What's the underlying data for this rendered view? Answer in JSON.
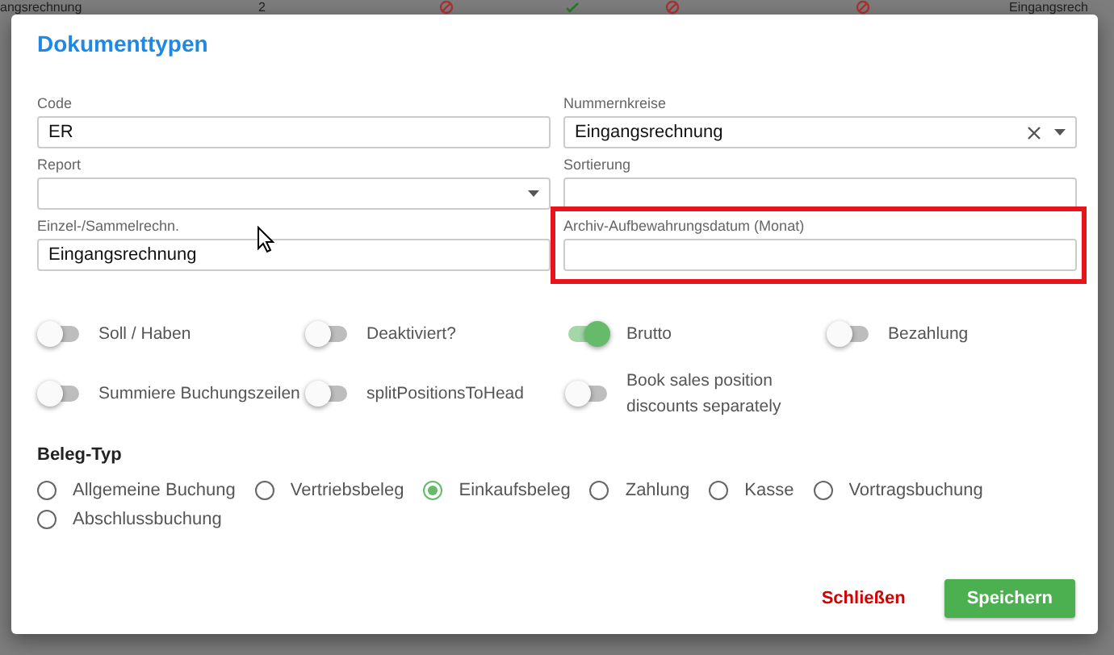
{
  "background_row": {
    "cells": [
      {
        "kind": "text",
        "text": "angsrechnung"
      },
      {
        "kind": "text",
        "text": "2"
      },
      {
        "kind": "blocked"
      },
      {
        "kind": "check"
      },
      {
        "kind": "blocked"
      },
      {
        "kind": "blocked"
      },
      {
        "kind": "text",
        "text": "Eingangsrech"
      }
    ]
  },
  "dialog": {
    "title": "Dokumenttypen",
    "fields": [
      {
        "kind": "text",
        "label": "Code",
        "value": "ER"
      },
      {
        "kind": "select",
        "label": "Nummernkreise",
        "value": "Eingangsrechnung",
        "clearable": true
      },
      {
        "kind": "select",
        "label": "Report"
      },
      {
        "kind": "text",
        "label": "Sortierung"
      },
      {
        "kind": "text",
        "label": "Einzel-/Sammelrechn.",
        "value": "Eingangsrechnung"
      },
      {
        "kind": "text",
        "label": "Archiv-Aufbewahrungsdatum (Monat)",
        "highlighted": true
      }
    ],
    "toggles": [
      {
        "label": "Soll / Haben",
        "on": false
      },
      {
        "label": "Deaktiviert?",
        "on": false
      },
      {
        "label": "Brutto",
        "on": true
      },
      {
        "label": "Bezahlung",
        "on": false
      },
      {
        "label": "Summiere Buchungszeilen",
        "on": false
      },
      {
        "label": "splitPositionsToHead",
        "on": false
      },
      {
        "label": "Book sales position discounts separately",
        "on": false
      }
    ],
    "radio_group": {
      "title": "Beleg-Typ",
      "options": [
        {
          "label": "Allgemeine Buchung",
          "selected": false
        },
        {
          "label": "Vertriebsbeleg",
          "selected": false
        },
        {
          "label": "Einkaufsbeleg",
          "selected": true
        },
        {
          "label": "Zahlung",
          "selected": false
        },
        {
          "label": "Kasse",
          "selected": false
        },
        {
          "label": "Vortragsbuchung",
          "selected": false
        },
        {
          "label": "Abschlussbuchung",
          "selected": false
        }
      ]
    },
    "buttons": [
      {
        "kind": "text",
        "label": "Schließen"
      },
      {
        "kind": "primary",
        "label": "Speichern"
      }
    ]
  }
}
